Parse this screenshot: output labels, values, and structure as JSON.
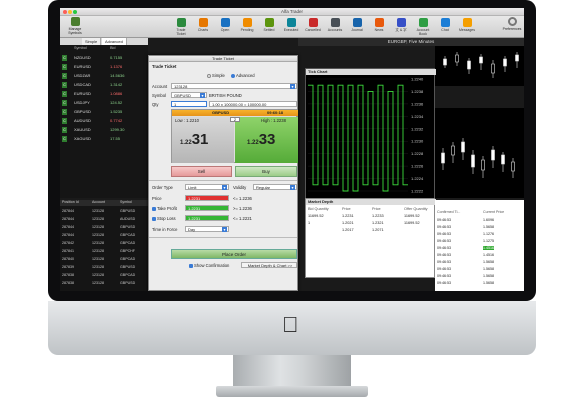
{
  "app": {
    "title": "Alfa Trader"
  },
  "toolbar": {
    "manage_symbols": "Manage Symbols",
    "items": [
      "Trade Ticket",
      "Charts",
      "Open",
      "Pending",
      "Settled",
      "Executed",
      "Cancelled",
      "Accounts",
      "Journal",
      "News",
      "文 & 字",
      "Account Book",
      "Chat",
      "Messages"
    ],
    "preferences": "Preferences"
  },
  "watchlist": {
    "tabs": [
      "Simple",
      "Advanced"
    ],
    "headers": [
      "",
      "Symbol",
      "Bid"
    ],
    "rows": [
      {
        "symbol": "NZDUSD",
        "bid": "0.7155"
      },
      {
        "symbol": "EURUSD",
        "bid": "1.1376"
      },
      {
        "symbol": "USDZAR",
        "bid": "14.5636"
      },
      {
        "symbol": "USDCAD",
        "bid": "1.3142"
      },
      {
        "symbol": "EURUSD",
        "bid": "1.0886"
      },
      {
        "symbol": "USDJPY",
        "bid": "124.52"
      },
      {
        "symbol": "GBPUSD",
        "bid": "1.5235"
      },
      {
        "symbol": "AUDUSD",
        "bid": "0.7742"
      },
      {
        "symbol": "XAUUSD",
        "bid": "1299.30"
      },
      {
        "symbol": "XAGUSD",
        "bid": "17.55"
      }
    ]
  },
  "orders": {
    "headers": [
      "Position Id",
      "Account",
      "Symbol"
    ],
    "rows": [
      {
        "id": "287844",
        "account": "123128",
        "symbol": "GBPUSD"
      },
      {
        "id": "287844",
        "account": "123128",
        "symbol": "AUDUSD"
      },
      {
        "id": "287844",
        "account": "123128",
        "symbol": "GBPUSD"
      },
      {
        "id": "287844",
        "account": "123128",
        "symbol": "GBPCAD"
      },
      {
        "id": "287842",
        "account": "123128",
        "symbol": "GBPCAD"
      },
      {
        "id": "287841",
        "account": "123128",
        "symbol": "GBPCHF"
      },
      {
        "id": "287840",
        "account": "123128",
        "symbol": "GBPCAD"
      },
      {
        "id": "287839",
        "account": "123128",
        "symbol": "GBPUSD"
      },
      {
        "id": "287838",
        "account": "123128",
        "symbol": "GBPCAD"
      },
      {
        "id": "287838",
        "account": "123128",
        "symbol": "GBPUSD"
      }
    ]
  },
  "ticket": {
    "window_title": "Trade Ticket",
    "section": "Trade Ticket",
    "mode_simple": "Simple",
    "mode_advanced": "Advanced",
    "account_label": "Account",
    "account_value": "123128",
    "symbol_label": "Symbol",
    "symbol_value": "GBPUSD",
    "symbol_name": "BRITISH POUND",
    "qty_label": "Qty",
    "qty_value": "1",
    "qty_hint": "1.00 x 100000.00 = 100000.00",
    "pair": "GBPUSD",
    "time": "09:60:18",
    "low_label": "Low : 1.2210",
    "spread": "2",
    "high_label": "High : 1.2238",
    "sell_prefix": "1.22",
    "sell_big": "31",
    "buy_prefix": "1.22",
    "buy_big": "33",
    "sell": "Sell",
    "buy": "Buy",
    "order_type_label": "Order Type",
    "order_type_value": "Limit",
    "validity_label": "Validity",
    "validity_value": "Regular",
    "price_label": "Price",
    "price_value": "1.2231",
    "price_calc": "<= 1.2236",
    "tp_label": "Take Profit",
    "tp_value": "1.2231",
    "tp_calc": ">= 1.2236",
    "sl_label": "Stop Loss",
    "sl_value": "1.2231",
    "sl_calc": "<= 1.2221",
    "tif_label": "Time in Force",
    "tif_value": "Day",
    "place_order": "Place Order",
    "show_confirmation": "Show Confirmation",
    "depth_button": "Market Depth & Chart >>"
  },
  "chart": {
    "header": "EURGBP, Five Minutes",
    "tick_title": "Tick Chart",
    "price_ticks": [
      "1.2240",
      "1.2238",
      "1.2236",
      "1.2234",
      "1.2232",
      "1.2230",
      "1.2228",
      "1.2226",
      "1.2224",
      "1.2222"
    ],
    "x_labels": [
      "25 Oct 09:29",
      "25 Oct 09:29"
    ],
    "tick_prices": [
      1.2239,
      1.2223,
      1.2239,
      1.2223,
      1.2239,
      1.2223,
      1.2239,
      1.2222,
      1.2239,
      1.2222,
      1.2239,
      1.2223,
      1.2238,
      1.2223,
      1.2239,
      1.2222,
      1.2238,
      1.2223,
      1.2239,
      1.2223
    ]
  },
  "depth": {
    "title": "Market Depth",
    "headers": [
      "Bid Quantity",
      "Price",
      "Price",
      "Offer Quantity"
    ],
    "rows": [
      [
        "11699.52",
        "1.2231",
        "1.2233",
        "11699.52"
      ],
      [
        "1",
        "1.2021",
        "1.2321",
        "11699.52"
      ],
      [
        "",
        "1.2017",
        "1.2071",
        ""
      ]
    ]
  },
  "right_table": {
    "headers": [
      "Confirmed Ti...",
      "Current Price"
    ],
    "rows": [
      [
        "09:46:53",
        "1.6096"
      ],
      [
        "09:46:53",
        "1.5658"
      ],
      [
        "09:46:53",
        "1.1276"
      ],
      [
        "09:46:53",
        "1.1275"
      ],
      [
        "09:46:53",
        "1.4516"
      ],
      [
        "09:46:53",
        "1.4516"
      ],
      [
        "09:46:53",
        "1.5658"
      ],
      [
        "09:46:53",
        "1.5658"
      ],
      [
        "09:46:53",
        "1.5658"
      ],
      [
        "09:46:53",
        "1.5658"
      ]
    ]
  }
}
